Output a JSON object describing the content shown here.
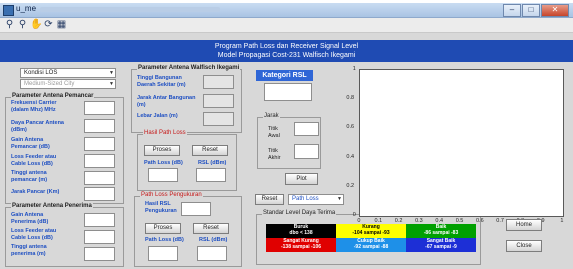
{
  "window": {
    "title": "u_me"
  },
  "banner": {
    "line1": "Program Path Loss dan Receiver Signal Level",
    "line2": "Model Propagasi Cost-231 Walfisch Ikegami"
  },
  "left": {
    "kondisi_popup": "Kondisi LOS",
    "area_popup": "Medium-Sized City",
    "pemancar_title": "Parameter Antena Pemancar",
    "freq_label": "Frekuensi Carrier (dalam Mhz) MHz",
    "daya_label": "Daya Pancar Antena (dBm)",
    "gain_tx_label": "Gain Antena Pemancar (dB)",
    "loss_tx_label": "Loss Feeder atau Cable Loss (dB)",
    "tinggi_tx_label": "Tinggi antena pemancar (m)",
    "jarak_label": "Jarak Pancar (Km)",
    "penerima_title": "Parameter Antena Penerima",
    "gain_rx_label": "Gain Antena Penerima (dB)",
    "loss_rx_label": "Loss Feeder atau Cable Loss (dB)",
    "tinggi_rx_label": "Tinggi antena penerima (m)"
  },
  "walfisch": {
    "title": "Parameter Antena Walfisch Ikegami",
    "tinggi_bangunan": "Tinggi Bangunan Daerah Sekitar (m)",
    "jarak_antar": "Jarak Antar Bangunan (m)",
    "lebar_jalan": "Lebar Jalan (m)"
  },
  "hasil": {
    "title": "Hasil Path Loss",
    "proses": "Proses",
    "reset": "Reset",
    "path_loss": "Path Loss (dB)",
    "rsl": "RSL (dBm)"
  },
  "pengukuran": {
    "title": "Path Loss Pengukuran",
    "hasil_rsl": "Hasil RSL Pengukuran",
    "proses": "Proses",
    "reset": "Reset",
    "path_loss": "Path Loss (dB)",
    "rsl": "RSL (dBm)"
  },
  "middle": {
    "kategori": "Kategori RSL",
    "jarak_title": "Jarak",
    "titik_awal": "Titik Awal",
    "titik_akhir": "Titik Akhir",
    "plot": "Plot",
    "reset": "Reset",
    "popup": "Path Loss"
  },
  "standar": {
    "title": "Standar Level Daya Terima",
    "cells": [
      {
        "t1": "Buruk",
        "t2": "dbo < 138",
        "bg": "#000000",
        "fg": "#ffffff"
      },
      {
        "t1": "Kurang",
        "t2": "-104 sampai -93",
        "bg": "#ffff00",
        "fg": "#000000"
      },
      {
        "t1": "Baik",
        "t2": "-86 sampai -83",
        "bg": "#00a000",
        "fg": "#ffffff"
      },
      {
        "t1": "Sangat Kurang",
        "t2": "-138 sampai -106",
        "bg": "#e00000",
        "fg": "#ffffff"
      },
      {
        "t1": "Cukup Baik",
        "t2": "-92 sampai -88",
        "bg": "#1e90e8",
        "fg": "#ffffff"
      },
      {
        "t1": "Sangat Baik",
        "t2": "-67 sampai -9",
        "bg": "#1d2fd6",
        "fg": "#ffffff"
      }
    ]
  },
  "right": {
    "home": "Home",
    "close": "Close"
  },
  "plot": {
    "yticks": [
      "1",
      "0.8",
      "0.6",
      "0.4",
      "0.2",
      "0"
    ],
    "xticks": [
      "0",
      "0.1",
      "0.2",
      "0.3",
      "0.4",
      "0.5",
      "0.6",
      "0.7",
      "0.8",
      "0.9",
      "1"
    ]
  }
}
